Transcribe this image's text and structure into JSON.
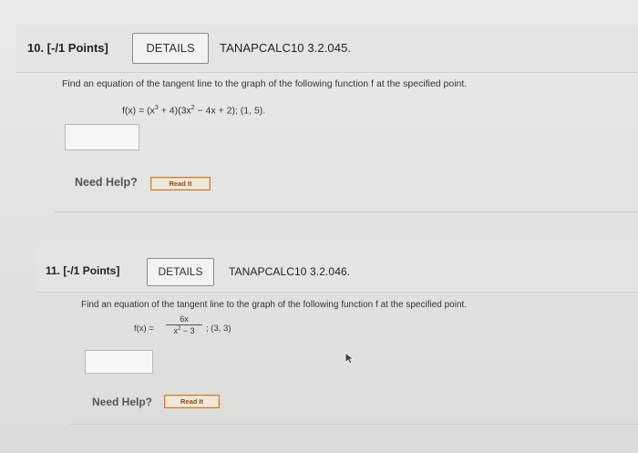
{
  "problems": [
    {
      "number_label": "10. [-/1 Points]",
      "details_label": "DETAILS",
      "code": "TANAPCALC10 3.2.045.",
      "instruction": "Find an equation of the tangent line to the graph of the following function f at the specified point.",
      "formula": {
        "lhs": "f(x) = (x",
        "exp1": "3",
        "mid": " + 4)(3x",
        "exp2": "2",
        "rhs": " − 4x + 2); (1, 5)."
      },
      "answer_value": "",
      "need_help_label": "Need Help?",
      "read_it_label": "Read It"
    },
    {
      "number_label": "11. [-/1 Points]",
      "details_label": "DETAILS",
      "code": "TANAPCALC10 3.2.046.",
      "instruction": "Find an equation of the tangent line to the graph of the following function f at the specified point.",
      "formula": {
        "lhs": "f(x) =",
        "numerator": "6x",
        "den_base": "x",
        "den_exp": "2",
        "den_rest": " − 3",
        "point": "; (3, 3)"
      },
      "answer_value": "",
      "need_help_label": "Need Help?",
      "read_it_label": "Read It"
    }
  ],
  "icons": {
    "cursor": "mouse-pointer-icon"
  },
  "colors": {
    "read_it_border": "#c97a3a",
    "read_it_text": "#8a4a1a"
  }
}
